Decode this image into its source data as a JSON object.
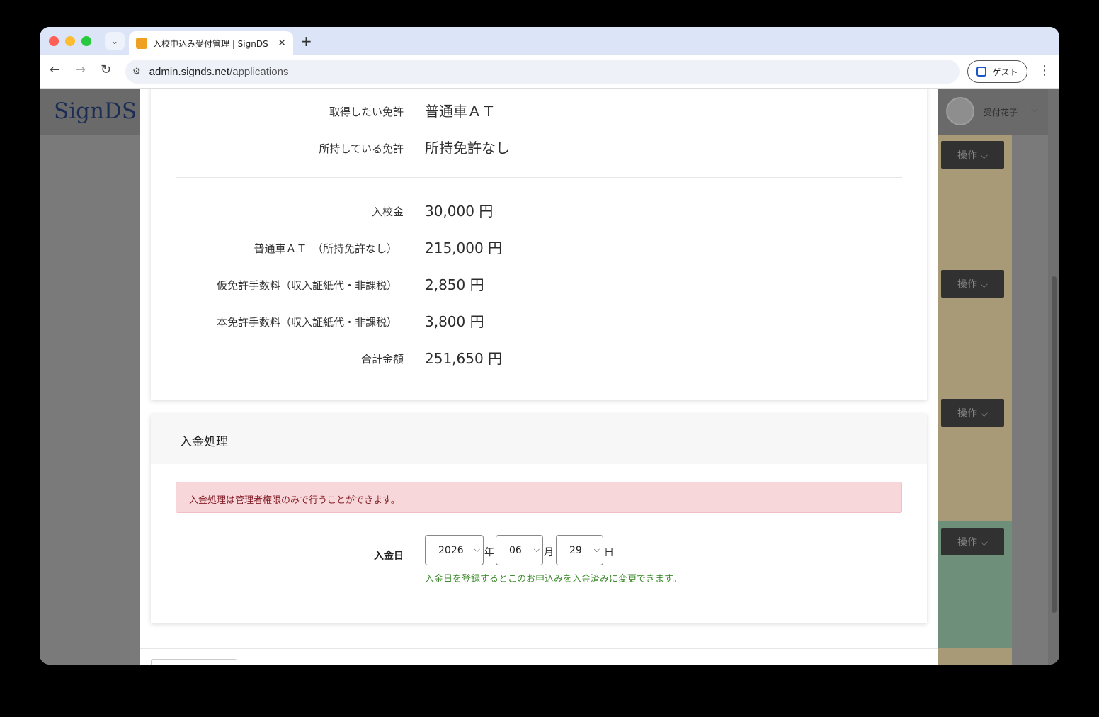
{
  "browser": {
    "tab_title": "入校申込み受付管理 | SignDS（",
    "url_host": "admin.signds.net",
    "url_path": "/applications",
    "guest_label": "ゲスト"
  },
  "header": {
    "logo": "SignDS",
    "user_name": "受付花子"
  },
  "sidebar_buttons": [
    "操作 ⌵",
    "操作 ⌵",
    "操作 ⌵",
    "操作 ⌵"
  ],
  "license": {
    "desired_label": "取得したい免許",
    "desired_value": "普通車ＡＴ",
    "held_label": "所持している免許",
    "held_value": "所持免許なし"
  },
  "fees": [
    {
      "label": "入校金",
      "value": "30,000 円"
    },
    {
      "label": "普通車ＡＴ　（所持免許なし）",
      "value": "215,000 円"
    },
    {
      "label": "仮免許手数料（収入証紙代・非課税）",
      "value": "2,850 円"
    },
    {
      "label": "本免許手数料（収入証紙代・非課税）",
      "value": "3,800 円"
    },
    {
      "label": "合計金額",
      "value": "251,650 円"
    }
  ],
  "payment": {
    "title": "入金処理",
    "alert": "入金処理は管理者権限のみで行うことができます。",
    "date_label": "入金日",
    "year": "2026",
    "year_unit": "年",
    "month": "06",
    "month_unit": "月",
    "day": "29",
    "day_unit": "日",
    "help": "入金日を登録するとこのお申込みを入金済みに変更できます。"
  },
  "colors": {
    "alert_bg": "#f8d7da",
    "alert_text": "#842029",
    "help_text": "#3f8a2e",
    "row_tan": "#a89a76",
    "row_green": "#6e8f7a"
  }
}
